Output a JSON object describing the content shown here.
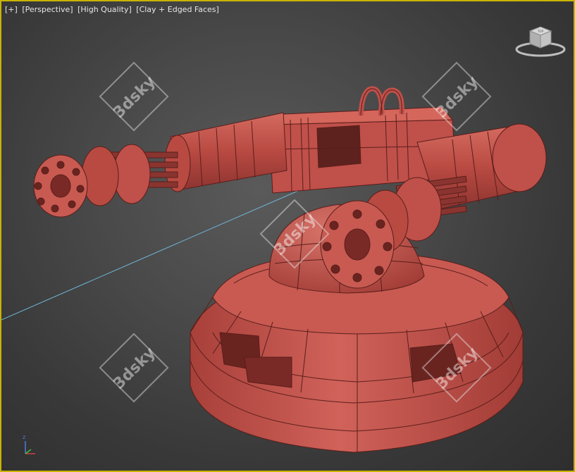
{
  "viewport": {
    "menu_label": "[+]",
    "view_label": "[Perspective]",
    "quality_label": "[High Quality]",
    "shading_label": "[Clay + Edged Faces]",
    "border_color": "#c8b400",
    "background_color": "#4a4a4a"
  },
  "model": {
    "color": "#c0504a",
    "edge_color": "#5a1e1a"
  },
  "watermark": {
    "text": "3dsky"
  },
  "viewcube": {
    "face_label": "TOP",
    "icon": "viewcube-icon"
  },
  "axis": {
    "z_label": "z",
    "icon": "axis-tripod-icon"
  }
}
